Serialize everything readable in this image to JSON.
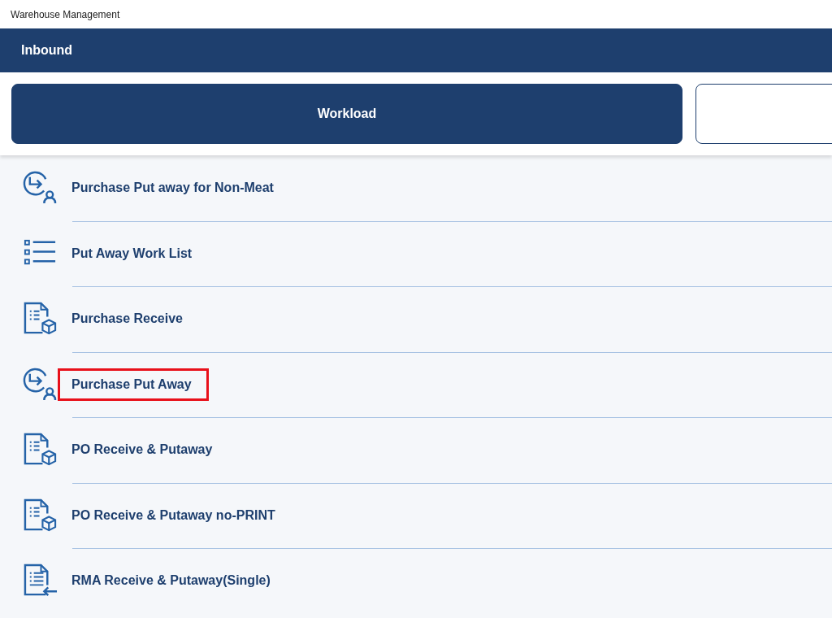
{
  "window": {
    "title": "Warehouse Management"
  },
  "header": {
    "title": "Inbound"
  },
  "tabs": [
    {
      "label": "Workload",
      "selected": true
    },
    {
      "selected": false
    }
  ],
  "menu_items": [
    {
      "label": "Purchase Put away for Non-Meat",
      "kind": "putaway",
      "highlighted": false
    },
    {
      "label": "Put Away Work List",
      "kind": "list",
      "highlighted": false
    },
    {
      "label": "Purchase Receive",
      "kind": "receive",
      "highlighted": false
    },
    {
      "label": "Purchase Put Away",
      "kind": "putaway",
      "highlighted": true
    },
    {
      "label": "PO Receive & Putaway",
      "kind": "receive",
      "highlighted": false
    },
    {
      "label": "PO Receive & Putaway no-PRINT",
      "kind": "receive",
      "highlighted": false
    },
    {
      "label": "RMA Receive & Putaway(Single)",
      "kind": "rma",
      "highlighted": false
    }
  ]
}
